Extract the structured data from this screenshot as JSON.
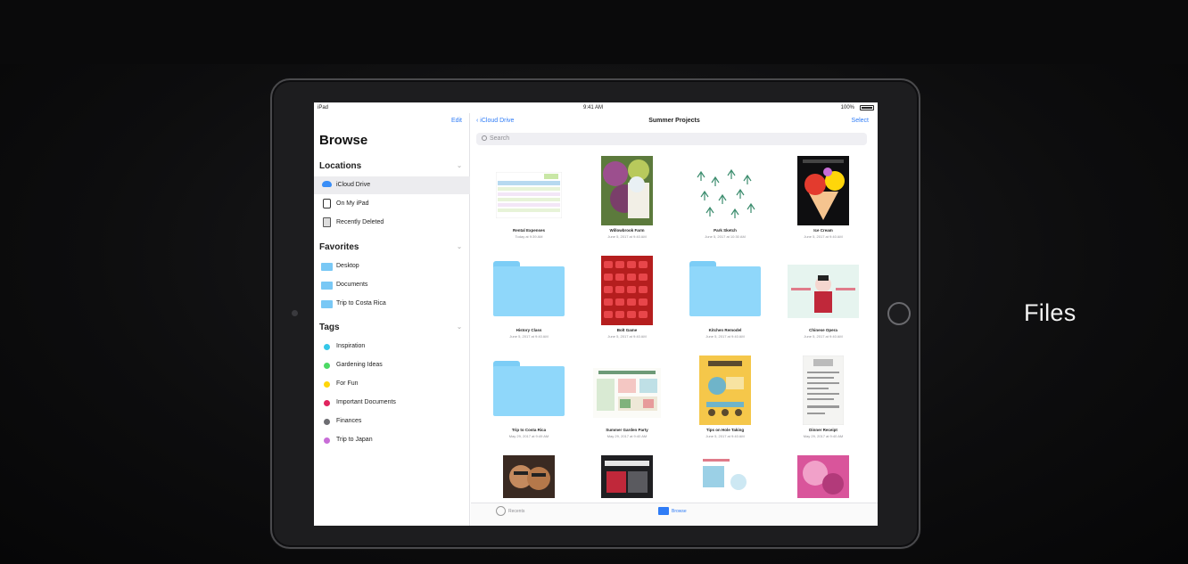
{
  "slide": {
    "title": "Files"
  },
  "statusbar": {
    "carrier": "iPad",
    "time": "9:41 AM",
    "battery": "100%"
  },
  "sidebar": {
    "edit_label": "Edit",
    "title": "Browse",
    "locations_header": "Locations",
    "locations": [
      {
        "label": "iCloud Drive",
        "icon": "cloud-icon",
        "selected": true
      },
      {
        "label": "On My iPad",
        "icon": "ipad-icon",
        "selected": false
      },
      {
        "label": "Recently Deleted",
        "icon": "trash-icon",
        "selected": false
      }
    ],
    "favorites_header": "Favorites",
    "favorites": [
      {
        "label": "Desktop",
        "icon": "folder-icon"
      },
      {
        "label": "Documents",
        "icon": "folder-icon"
      },
      {
        "label": "Trip to Costa Rica",
        "icon": "folder-icon"
      }
    ],
    "tags_header": "Tags",
    "tags": [
      {
        "label": "Inspiration",
        "color": "#35c7e8"
      },
      {
        "label": "Gardening Ideas",
        "color": "#4cd964"
      },
      {
        "label": "For Fun",
        "color": "#ffd60a"
      },
      {
        "label": "Important Documents",
        "color": "#e0245e"
      },
      {
        "label": "Finances",
        "color": "#6d6d72"
      },
      {
        "label": "Trip to Japan",
        "color": "#c86dd7"
      }
    ]
  },
  "main": {
    "back_label": "iCloud Drive",
    "title": "Summer Projects",
    "select_label": "Select",
    "search_placeholder": "Search",
    "files": [
      {
        "name": "Rental Expenses",
        "date": "Today at 9:39 AM",
        "kind": "spreadsheet"
      },
      {
        "name": "Willowbrook Farm",
        "date": "June 5, 2017 at 9:40 AM",
        "kind": "poster-green"
      },
      {
        "name": "Park Sketch",
        "date": "June 5, 2017 at 10:30 AM",
        "kind": "sketch"
      },
      {
        "name": "Ice Cream",
        "date": "June 5, 2017 at 9:40 AM",
        "kind": "icecream"
      },
      {
        "name": "History Class",
        "date": "June 5, 2017 at 9:40 AM",
        "kind": "folder"
      },
      {
        "name": "Bolt Game",
        "date": "June 5, 2017 at 9:40 AM",
        "kind": "photo-red"
      },
      {
        "name": "Kitchen Remodel",
        "date": "June 5, 2017 at 9:40 AM",
        "kind": "folder"
      },
      {
        "name": "Chinese Opera",
        "date": "June 5, 2017 at 9:40 AM",
        "kind": "opera"
      },
      {
        "name": "Trip to Costa Rica",
        "date": "May 29, 2017 at 9:49 AM",
        "kind": "folder"
      },
      {
        "name": "Summer Garden Party",
        "date": "May 29, 2017 at 9:40 AM",
        "kind": "garden"
      },
      {
        "name": "Tips on Hole Taking",
        "date": "June 5, 2017 at 9:40 AM",
        "kind": "yellow"
      },
      {
        "name": "Dinner Receipt",
        "date": "May 29, 2017 at 9:40 AM",
        "kind": "receipt"
      },
      {
        "name": "",
        "date": "",
        "kind": "photo-face"
      },
      {
        "name": "",
        "date": "",
        "kind": "photo-dark"
      },
      {
        "name": "",
        "date": "",
        "kind": "doc-blue"
      },
      {
        "name": "",
        "date": "",
        "kind": "photo-pink"
      }
    ],
    "tabs": {
      "recents": "Recents",
      "browse": "Browse"
    }
  }
}
